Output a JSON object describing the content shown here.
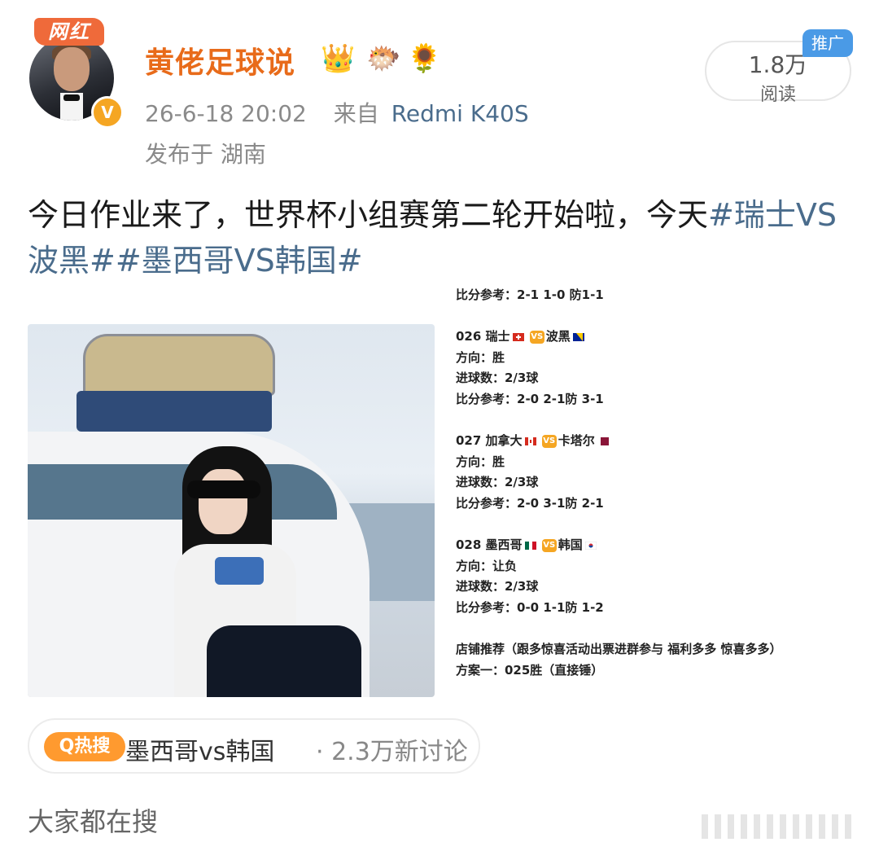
{
  "user": {
    "badge": "网红",
    "name": "黄佬足球说",
    "verified": "V",
    "timestamp": "26-6-18 20:02",
    "source_prefix": "来自",
    "device": "Redmi K40S",
    "location": "发布于 湖南",
    "emoji": [
      "👑",
      "🐡",
      "🌻"
    ]
  },
  "stats": {
    "reads": "1.8万",
    "reads_label": "阅读",
    "promo": "推广"
  },
  "post": {
    "text_before": "今日作业来了，世界杯小组赛第二轮开始啦，今天",
    "tag1": "#瑞士VS波黑#",
    "tag2": "#墨西哥VS韩国#"
  },
  "image_card": {
    "line1": "比分参考：2-1 1-0 防1-1",
    "m1_title_a": "026 瑞士",
    "m1_title_b": "波黑",
    "m1_dir": "方向：胜",
    "m1_goals": "进球数：2/3球",
    "m1_score": "比分参考：2-0 2-1防 3-1",
    "m2_title_a": "027 加拿大",
    "m2_title_b": "卡塔尔",
    "m2_dir": "方向：胜",
    "m2_goals": "进球数：2/3球",
    "m2_score": "比分参考：2-0 3-1防 2-1",
    "m3_title_a": "028 墨西哥",
    "m3_title_b": "韩国",
    "m3_dir": "方向：让负",
    "m3_goals": "进球数：2/3球",
    "m3_score": "比分参考：0-0 1-1防 1-2",
    "shop": "店铺推荐（跟多惊喜活动出票进群参与 福利多多 惊喜多多）",
    "plan": "方案一：025胜（直接锤）",
    "vs": "VS"
  },
  "hot_search": {
    "badge": "Q热搜",
    "topic": "墨西哥vs韩国",
    "stat": "· 2.3万新讨论"
  },
  "footer": {
    "label": "大家都在搜"
  }
}
